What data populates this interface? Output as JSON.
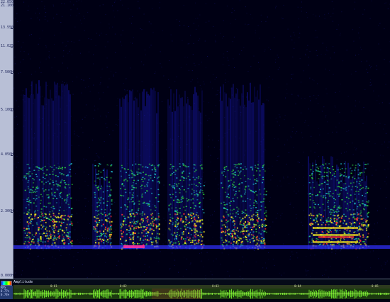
{
  "frequency_axis": {
    "labels": [
      "22.050",
      "21.100",
      "13.550",
      "11.025",
      "7.500Hz",
      "5.100Hz",
      "4.050Hz",
      "2.300Hz",
      "0.000Hz"
    ]
  },
  "bottom_panel": {
    "legend_label": "Amplitude",
    "side_labels": [
      "RMS",
      "0.77%",
      "0.74%"
    ],
    "time_labels": [
      "0:00",
      "0:01",
      "0:02",
      "0:03",
      "0:04",
      "0:05"
    ]
  },
  "colors": {
    "background": "#000014",
    "low": "#1a1aff",
    "mid": "#00ff40",
    "high": "#ffff00",
    "peak": "#ff2020",
    "waveform": "#7cff30"
  }
}
